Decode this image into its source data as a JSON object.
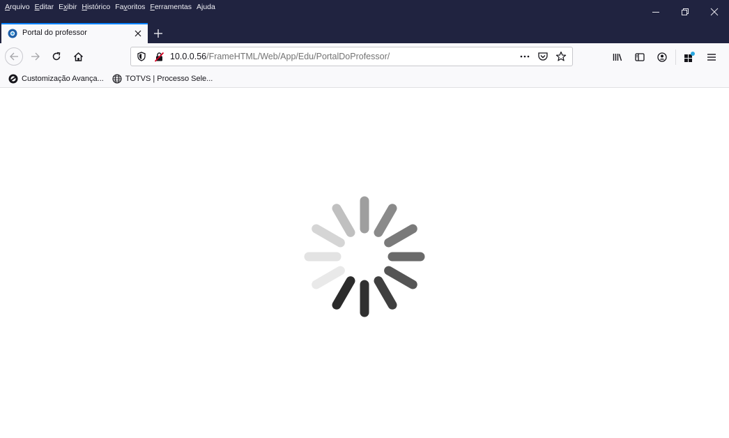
{
  "menubar": {
    "items": [
      "Arquivo",
      "Editar",
      "Exibir",
      "Histórico",
      "Favoritos",
      "Ferramentas",
      "Ajuda"
    ],
    "accesskeys": [
      "A",
      "E",
      "x",
      "H",
      "v",
      "F",
      "j"
    ]
  },
  "window": {
    "minimize_icon": "minimize-icon",
    "restore_icon": "restore-icon",
    "close_icon": "close-icon"
  },
  "tab": {
    "title": "Portal do professor",
    "favicon": "totvs-favicon-icon"
  },
  "urlbar": {
    "host": "10.0.0.56",
    "path": "/FrameHTML/Web/App/Edu/PortalDoProfessor/"
  },
  "bookmarks": [
    {
      "label": "Customização Avança...",
      "icon": "totvs-circle-icon"
    },
    {
      "label": "TOTVS | Processo Sele...",
      "icon": "globe-icon"
    }
  ],
  "colors": {
    "titlebar": "#202340",
    "toolbar": "#f9f9fb",
    "tab_accent": "#0a84ff",
    "spinner_dark": "#333333",
    "spinner_light": "#e6e6e6"
  }
}
